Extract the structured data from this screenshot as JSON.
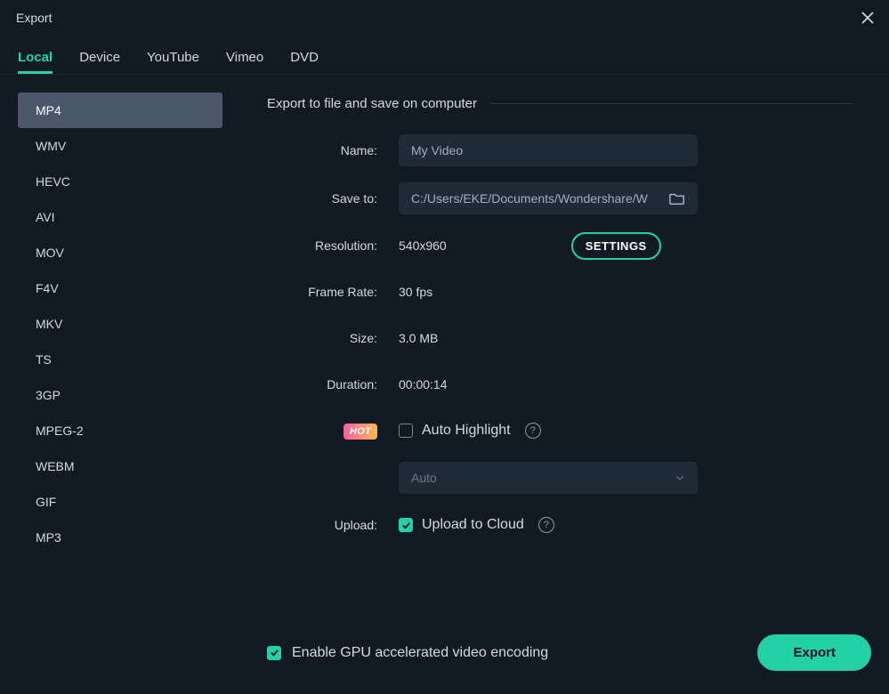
{
  "titlebar": {
    "title": "Export"
  },
  "tabs": [
    "Local",
    "Device",
    "YouTube",
    "Vimeo",
    "DVD"
  ],
  "activeTab": 0,
  "formats": [
    "MP4",
    "WMV",
    "HEVC",
    "AVI",
    "MOV",
    "F4V",
    "MKV",
    "TS",
    "3GP",
    "MPEG-2",
    "WEBM",
    "GIF",
    "MP3"
  ],
  "activeFormat": 0,
  "main": {
    "sectionTitle": "Export to file and save on computer",
    "labels": {
      "name": "Name:",
      "saveTo": "Save to:",
      "resolution": "Resolution:",
      "frameRate": "Frame Rate:",
      "size": "Size:",
      "duration": "Duration:",
      "upload": "Upload:"
    },
    "values": {
      "name": "My Video",
      "saveTo": "C:/Users/EKE/Documents/Wondershare/W",
      "resolution": "540x960",
      "frameRate": "30 fps",
      "size": "3.0 MB",
      "duration": "00:00:14"
    },
    "settingsButton": "SETTINGS",
    "hotBadge": "HOT",
    "autoHighlight": {
      "label": "Auto Highlight",
      "checked": false,
      "select": "Auto"
    },
    "upload": {
      "label": "Upload to Cloud",
      "checked": true
    }
  },
  "footer": {
    "gpuLabel": "Enable GPU accelerated video encoding",
    "gpuChecked": true,
    "exportButton": "Export"
  }
}
